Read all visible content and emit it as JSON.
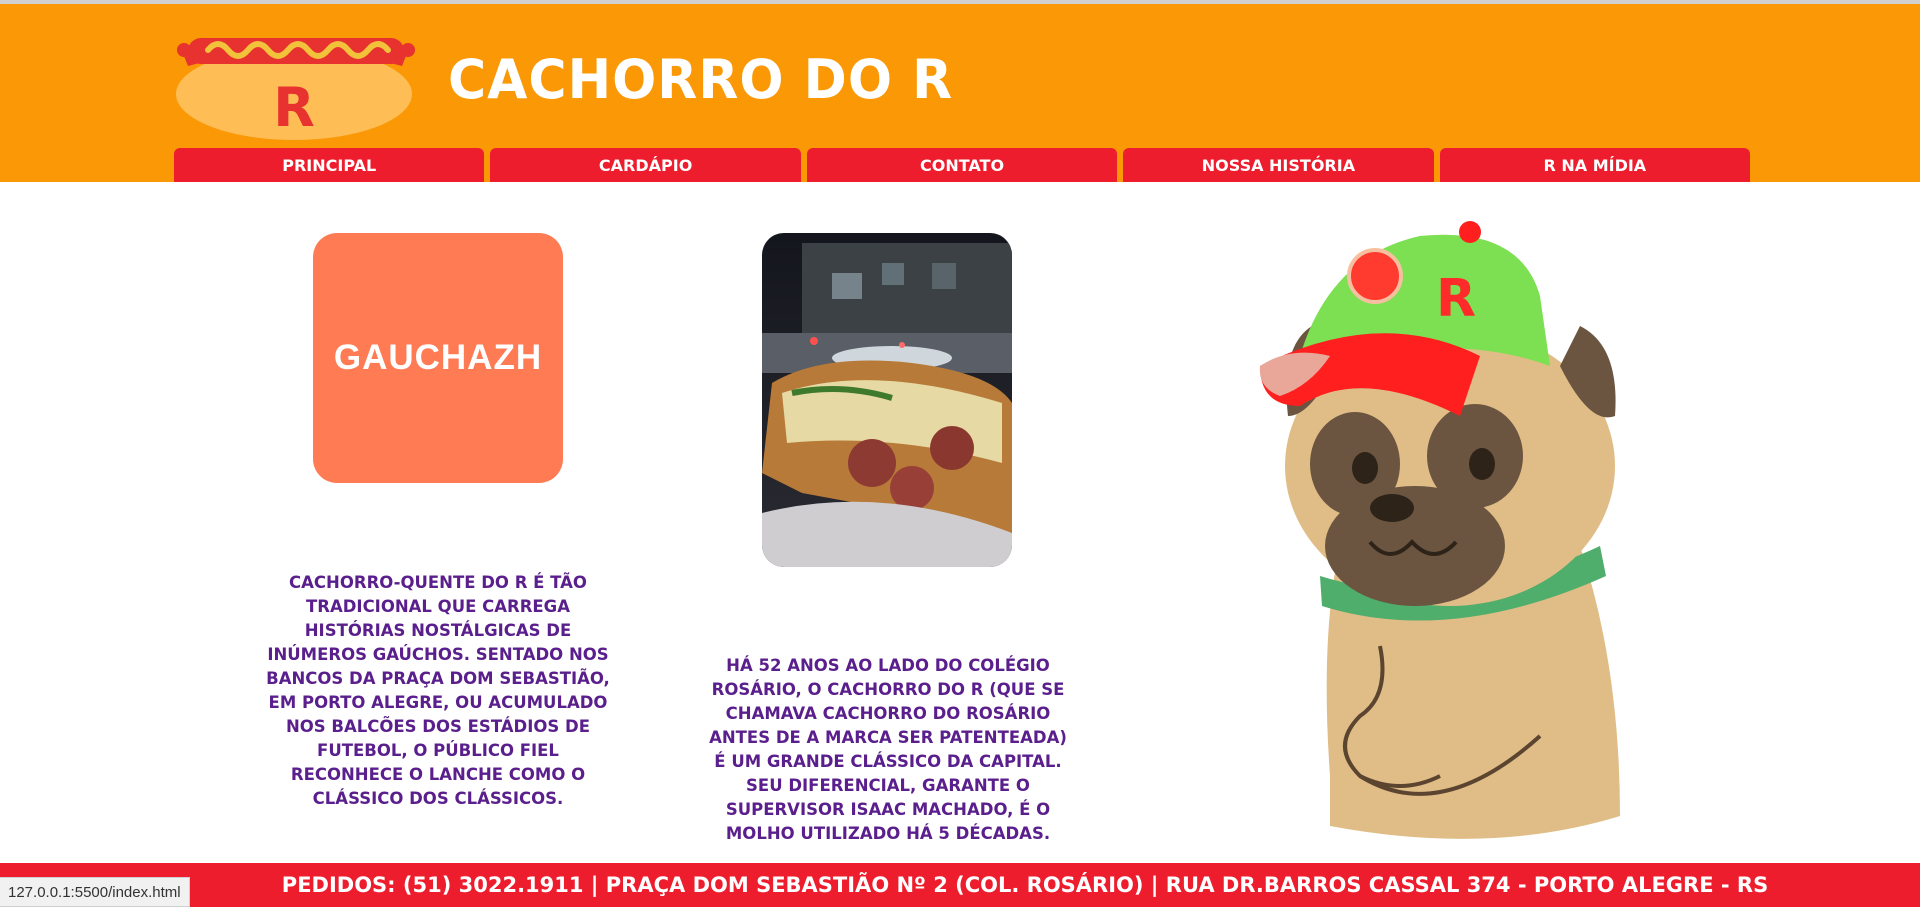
{
  "header": {
    "logo_letter": "R",
    "site_title": "CACHORRO DO R"
  },
  "nav": {
    "items": [
      "PRINCIPAL",
      "CARDÁPIO",
      "CONTATO",
      "NOSSA HISTÓRIA",
      "R NA MÍDIA"
    ]
  },
  "main": {
    "media_logo_text": "GAUCHAZH",
    "paragraph_1": "Cachorro-quente do R é tão tradicional que carrega histórias nostálgicas de inúmeros gaúchos. Sentado nos bancos da Praça Dom Sebastião, em Porto Alegre, ou acumulado nos balcões dos estádios de futebol, o público fiel reconhece o lanche como o clássico dos clássicos.",
    "paragraph_2": "Há 52 anos ao lado do Colégio Rosário, o Cachorro do R (que se chamava Cachorro do Rosário antes de a marca ser patenteada) é um grande clássico da Capital. Seu diferencial, garante o supervisor Isaac Machado, é o molho utilizado há 5 décadas.",
    "mascot_cap_letter": "R"
  },
  "footer": {
    "text": "PEDIDOS: (51) 3022.1911 | PRAÇA DOM SEBASTIÃO Nº 2 (COL. ROSÁRIO) | RUA DR.BARROS CASSAL 374 - PORTO ALEGRE - RS"
  },
  "status_bar": {
    "url": "127.0.0.1:5500/index.html"
  },
  "colors": {
    "header_orange": "#fa9806",
    "nav_red": "#ee1d2e",
    "text_purple": "#5a1f8c",
    "gauchazh_orange": "#ff7b54"
  }
}
